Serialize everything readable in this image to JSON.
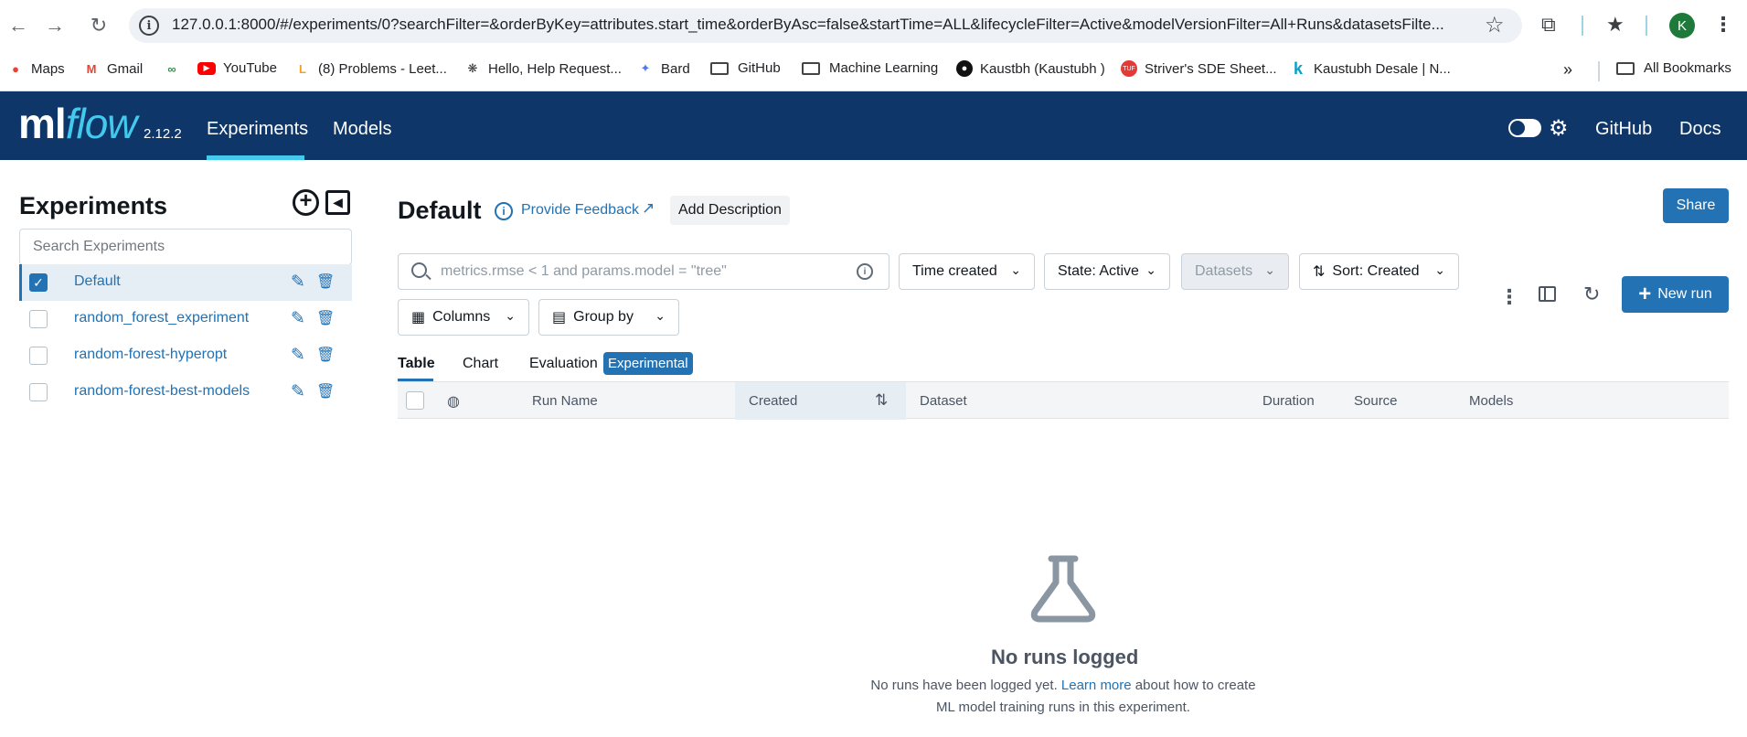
{
  "browser": {
    "url": "127.0.0.1:8000/#/experiments/0?searchFilter=&orderByKey=attributes.start_time&orderByAsc=false&startTime=ALL&lifecycleFilter=Active&modelVersionFilter=All+Runs&datasetsFilte...",
    "profile_initial": "K",
    "bookmarks": [
      {
        "label": "Maps",
        "icon": "maps-icon"
      },
      {
        "label": "Gmail",
        "icon": "gmail-icon"
      },
      {
        "label": "",
        "icon": "geeksforgeeks-icon"
      },
      {
        "label": "YouTube",
        "icon": "youtube-icon"
      },
      {
        "label": "(8) Problems - Leet...",
        "icon": "leetcode-icon"
      },
      {
        "label": "Hello, Help Request...",
        "icon": "openai-icon"
      },
      {
        "label": "Bard",
        "icon": "bard-icon"
      },
      {
        "label": "GitHub",
        "icon": "folder-icon"
      },
      {
        "label": "Machine Learning",
        "icon": "folder-icon"
      },
      {
        "label": "Kaustbh (Kaustubh )",
        "icon": "github-icon"
      },
      {
        "label": "Striver's SDE Sheet...",
        "icon": "tuf-icon"
      },
      {
        "label": "Kaustubh Desale | N...",
        "icon": "k-icon"
      }
    ],
    "all_bookmarks": "All Bookmarks"
  },
  "header": {
    "logo_ml": "ml",
    "logo_flow": "flow",
    "version": "2.12.2",
    "nav": [
      "Experiments",
      "Models"
    ],
    "links": [
      "GitHub",
      "Docs"
    ]
  },
  "sidebar": {
    "title": "Experiments",
    "search_placeholder": "Search Experiments",
    "experiments": [
      {
        "name": "Default",
        "selected": true
      },
      {
        "name": "random_forest_experiment",
        "selected": false
      },
      {
        "name": "random-forest-hyperopt",
        "selected": false
      },
      {
        "name": "random-forest-best-models",
        "selected": false
      }
    ]
  },
  "main": {
    "title": "Default",
    "feedback": "Provide Feedback",
    "add_description": "Add Description",
    "share": "Share",
    "search_placeholder": "metrics.rmse < 1 and params.model = \"tree\"",
    "filters": {
      "time": "Time created",
      "state": "State: Active",
      "datasets": "Datasets",
      "sort": "Sort: Created",
      "columns": "Columns",
      "group_by": "Group by"
    },
    "new_run": "New run",
    "tabs": [
      "Table",
      "Chart",
      "Evaluation"
    ],
    "experimental_badge": "Experimental",
    "columns": [
      "Run Name",
      "Created",
      "Dataset",
      "Duration",
      "Source",
      "Models"
    ],
    "empty": {
      "title": "No runs logged",
      "text_before": "No runs have been logged yet. ",
      "link": "Learn more",
      "text_after": " about how to create ML model training runs in this experiment."
    }
  },
  "colors": {
    "header_bg": "#0e3669",
    "accent": "#2272b4",
    "logo_flow": "#43c9ed"
  }
}
